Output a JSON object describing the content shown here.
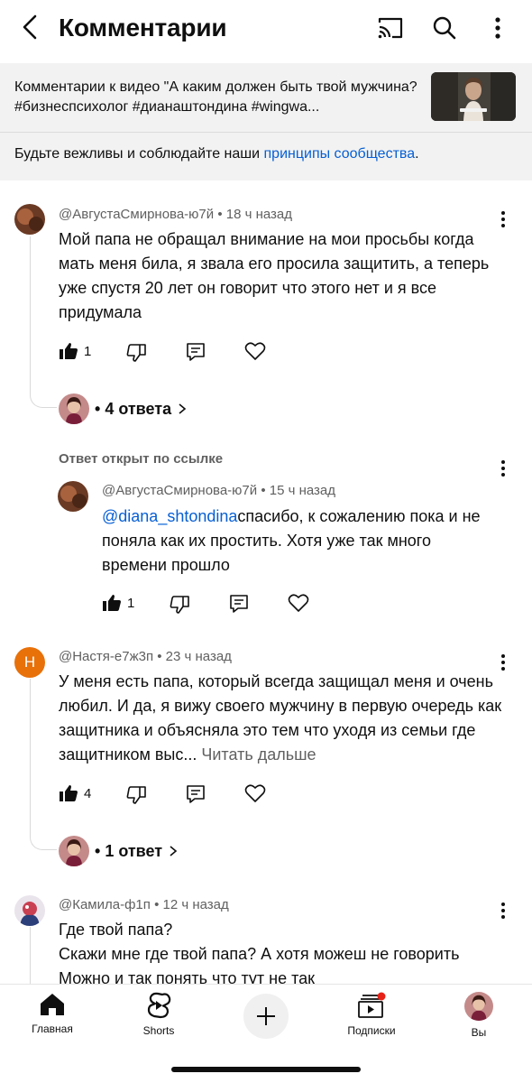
{
  "header": {
    "title": "Комментарии"
  },
  "video": {
    "description": "Комментарии к видео \"А каким должен быть твой мужчина? #бизнеспсихолог #дианаштондина #wingwa...",
    "rules_prefix": "Будьте вежливы и соблюдайте наши ",
    "rules_link": "принципы сообщества",
    "rules_suffix": "."
  },
  "comments": [
    {
      "author": "@АвгустаСмирнова-ю7й",
      "time": "18 ч назад",
      "text": "Мой папа не обращал внимание на мои просьбы когда мать меня била, я звала его просила защитить, а теперь уже спустя 20 лет он говорит что этого нет и я все придумала",
      "likes": "1",
      "replies": "4 ответа"
    },
    {
      "author": "@Настя-е7ж3п",
      "time": "23 ч назад",
      "avatar_letter": "Н",
      "text": "У меня есть папа, который всегда защищал меня и очень любил. И да, я вижу своего мужчину в первую очередь как защитника и объясняла это тем что уходя из семьи где защитником выс...",
      "read_more": "Читать дальше",
      "likes": "4",
      "replies": "1 ответ"
    },
    {
      "author": "@Камила-ф1п",
      "time": "12 ч назад",
      "text_line1": "Где твой папа?",
      "text_line2": "Скажи мне где твой папа? А хотя можеш не говорить",
      "text_line3": "Можно и так понять что тут не так"
    }
  ],
  "linked_reply": {
    "label": "Ответ открыт по ссылке",
    "author": "@АвгустаСмирнова-ю7й",
    "time": "15 ч назад",
    "mention": "@diana_shtondina",
    "text": "спасибо, к сожалению пока и не поняла как их простить. Хотя уже так много времени прошло",
    "likes": "1"
  },
  "nav": {
    "home": "Главная",
    "shorts": "Shorts",
    "subscriptions": "Подписки",
    "you": "Вы"
  },
  "colors": {
    "link": "#065fd4",
    "avatar_orange": "#e8710a",
    "notification_red": "#e62117"
  }
}
